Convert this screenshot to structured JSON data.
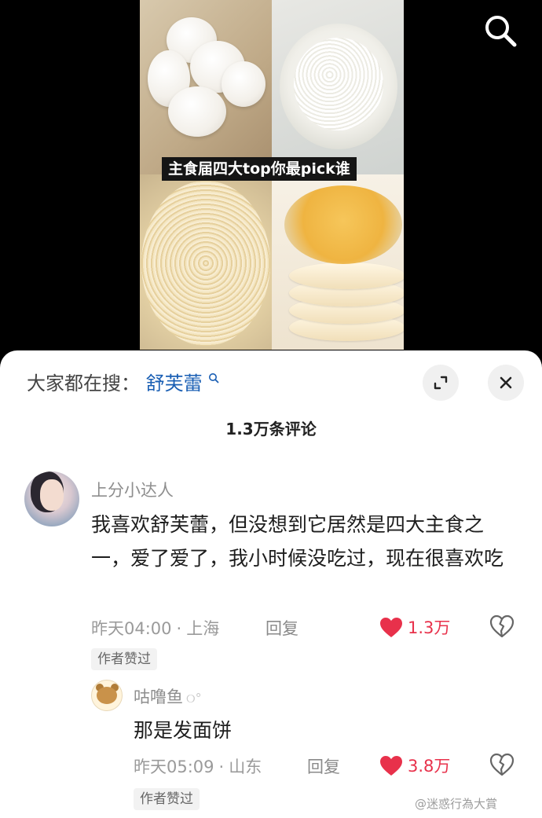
{
  "video": {
    "caption": "主食届四大top你最pick谁",
    "images": [
      "steamed-buns",
      "rice-bowl",
      "noodles",
      "souffle-cakes"
    ],
    "search_icon": "search-icon"
  },
  "sheet": {
    "hot_search": {
      "label": "大家都在搜：",
      "term": "舒芙蕾",
      "term_icon": "🔍"
    },
    "comment_count": "1.3万条评论"
  },
  "comments": [
    {
      "username": "上分小达人",
      "text": "我喜欢舒芙蕾，但没想到它居然是四大主食之一，爱了爱了，我小时候没吃过，现在很喜欢吃",
      "time": "昨天04:00",
      "location": "上海",
      "reply_label": "回复",
      "likes": "1.3万",
      "author_badge": "作者赞过"
    },
    {
      "username": "咕噜鱼",
      "username_badge": "୦°",
      "text": "那是发面饼",
      "time": "昨天05:09",
      "location": "山东",
      "reply_label": "回复",
      "likes": "3.8万",
      "author_badge": "作者赞过"
    }
  ],
  "watermark": "@迷惑行為大賞",
  "colors": {
    "like_red": "#e8314b",
    "link_blue": "#1a5fb4",
    "sheet_bg": "#ffffff",
    "video_bg": "#000000"
  }
}
